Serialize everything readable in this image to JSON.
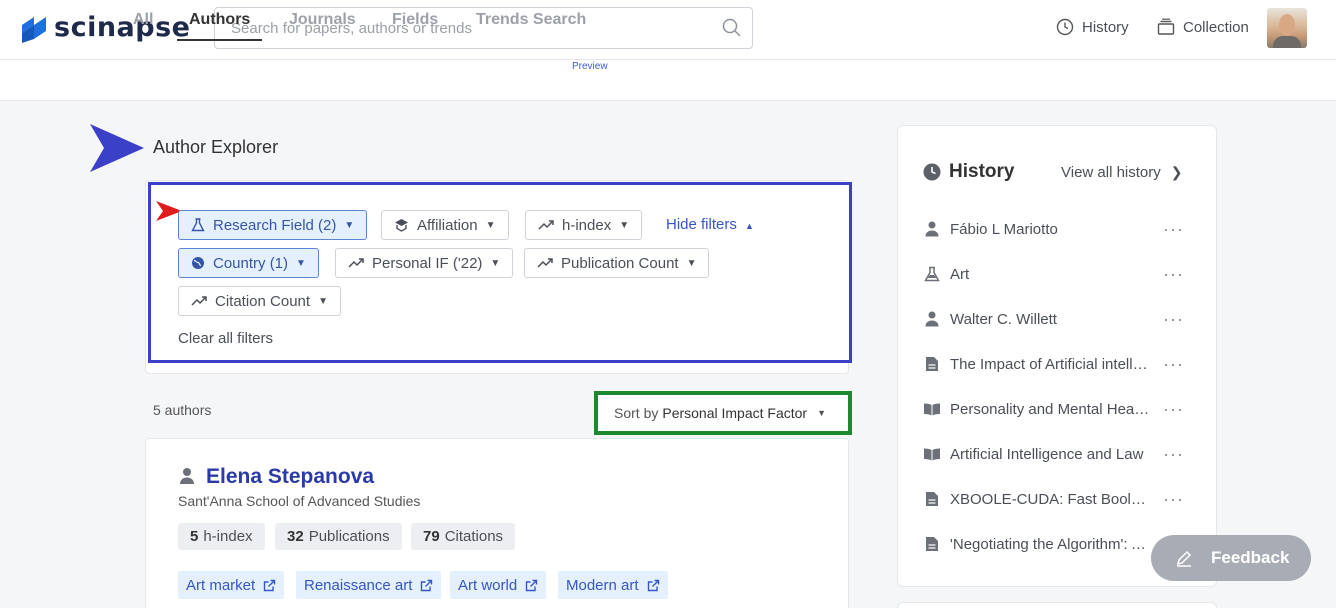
{
  "app": {
    "name": "scinapse"
  },
  "search": {
    "placeholder": "Search for papers, authors or trends"
  },
  "topnav": {
    "history": "History",
    "collection": "Collection"
  },
  "tabs": [
    {
      "label": "All"
    },
    {
      "label": "Authors"
    },
    {
      "label": "Journals"
    },
    {
      "label": "Fields"
    },
    {
      "label": "Trends Search"
    }
  ],
  "tab_badge": "Preview",
  "page_title": "Author Explorer",
  "filters": {
    "research_field": "Research Field (2)",
    "affiliation": "Affiliation",
    "h_index": "h-index",
    "hide_filters": "Hide filters",
    "country": "Country (1)",
    "personal_if": "Personal IF ('22)",
    "publication_count": "Publication Count",
    "citation_count": "Citation Count",
    "clear_all": "Clear all filters"
  },
  "results": {
    "count": "5 authors",
    "sort_prefix": "Sort by",
    "sort_value": "Personal Impact Factor"
  },
  "author": {
    "name": "Elena Stepanova",
    "affiliation": "Sant'Anna School of Advanced Studies",
    "stats": [
      {
        "value": "5",
        "label": "h-index"
      },
      {
        "value": "32",
        "label": "Publications"
      },
      {
        "value": "79",
        "label": "Citations"
      }
    ],
    "fields": [
      "Art market",
      "Renaissance art",
      "Art world",
      "Modern art"
    ]
  },
  "history": {
    "title": "History",
    "view_all": "View all history",
    "items": [
      {
        "icon": "person-icon",
        "text": "Fábio L Mariotto"
      },
      {
        "icon": "flask-icon",
        "text": "Art"
      },
      {
        "icon": "person-icon",
        "text": "Walter C. Willett"
      },
      {
        "icon": "document-icon",
        "text": "The Impact of Artificial intelligence"
      },
      {
        "icon": "book-icon",
        "text": "Personality and Mental Health"
      },
      {
        "icon": "book-icon",
        "text": "Artificial Intelligence and Law"
      },
      {
        "icon": "document-icon",
        "text": "XBOOLE-CUDA: Fast Boolean"
      },
      {
        "icon": "document-icon",
        "text": "'Negotiating the Algorithm': Automation"
      }
    ]
  },
  "feedback": "Feedback",
  "colors": {
    "brand": "#1f6fe0",
    "annotation_blue": "#3a40c8",
    "annotation_green": "#1b8a2e",
    "annotation_red": "#e01b1b",
    "link": "#3556c7"
  }
}
